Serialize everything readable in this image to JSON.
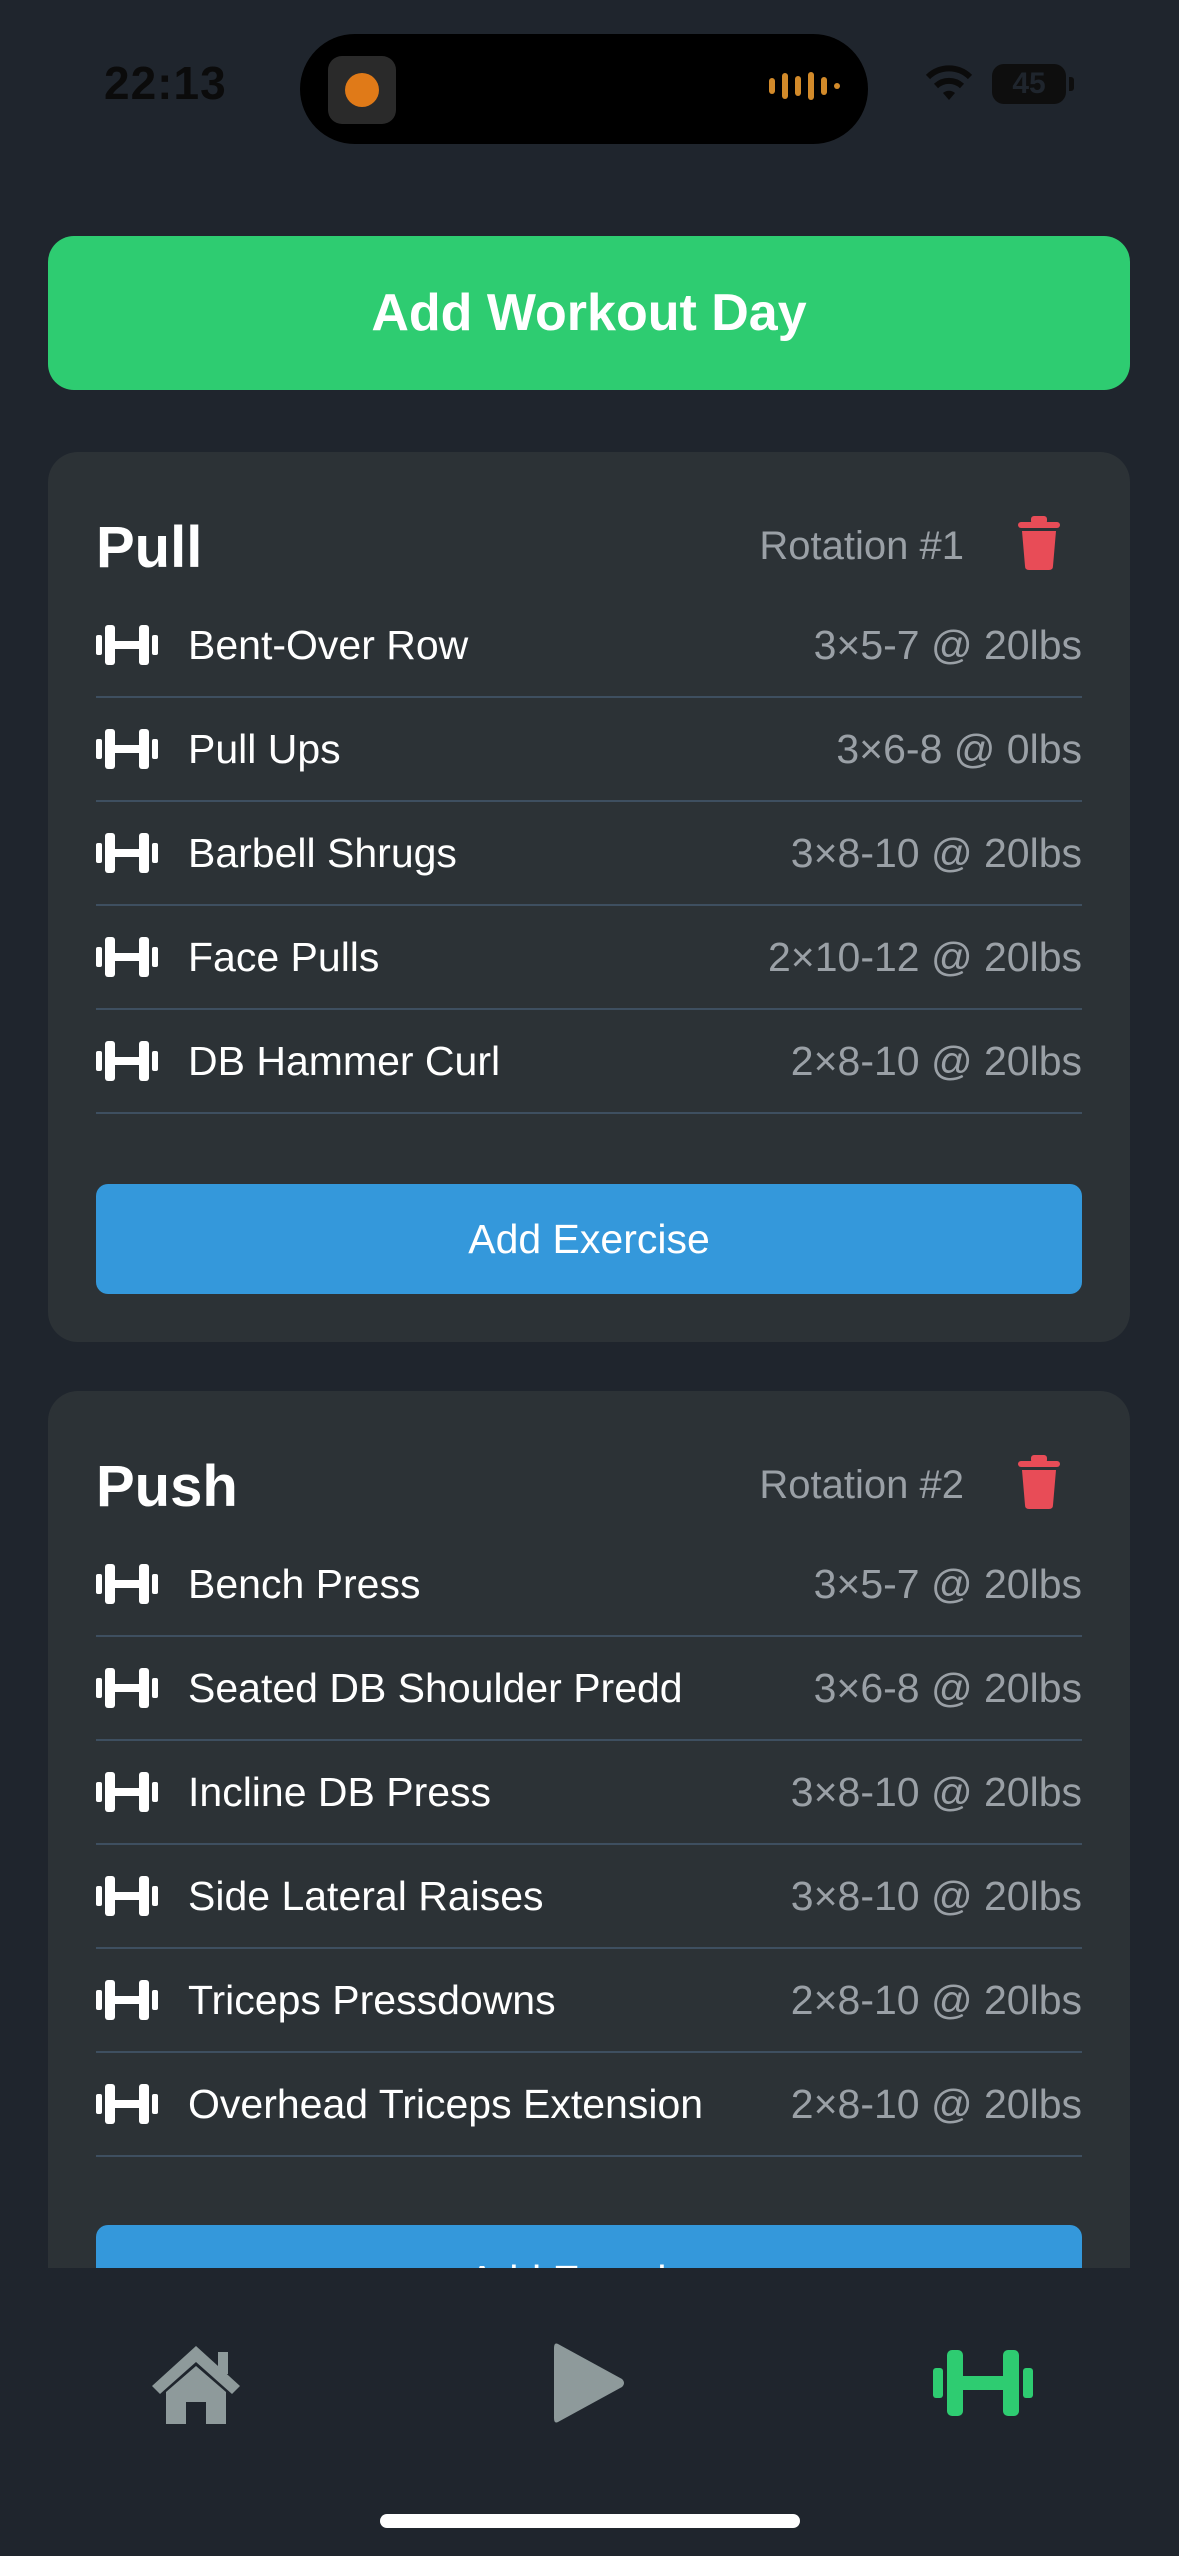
{
  "status_bar": {
    "time": "22:13",
    "battery": "45"
  },
  "add_day_label": "Add Workout Day",
  "days": [
    {
      "title": "Pull",
      "rotation": "Rotation #1",
      "exercises": [
        {
          "name": "Bent-Over Row",
          "sets": "3×5-7 @ 20lbs"
        },
        {
          "name": "Pull Ups",
          "sets": "3×6-8 @ 0lbs"
        },
        {
          "name": "Barbell Shrugs",
          "sets": "3×8-10 @ 20lbs"
        },
        {
          "name": "Face Pulls",
          "sets": "2×10-12 @ 20lbs"
        },
        {
          "name": "DB Hammer Curl",
          "sets": "2×8-10 @ 20lbs"
        }
      ],
      "add_exercise_label": "Add Exercise"
    },
    {
      "title": "Push",
      "rotation": "Rotation #2",
      "exercises": [
        {
          "name": "Bench Press",
          "sets": "3×5-7 @ 20lbs"
        },
        {
          "name": "Seated DB Shoulder Predd",
          "sets": "3×6-8 @ 20lbs"
        },
        {
          "name": "Incline DB Press",
          "sets": "3×8-10 @ 20lbs"
        },
        {
          "name": "Side Lateral Raises",
          "sets": "3×8-10 @ 20lbs"
        },
        {
          "name": "Triceps Pressdowns",
          "sets": "2×8-10 @ 20lbs"
        },
        {
          "name": "Overhead Triceps Extension",
          "sets": "2×8-10 @ 20lbs"
        }
      ],
      "add_exercise_label": "Add Exercise"
    }
  ],
  "tabs": [
    {
      "icon": "home-icon",
      "active": false
    },
    {
      "icon": "play-icon",
      "active": false
    },
    {
      "icon": "dumbbell-icon",
      "active": true
    }
  ],
  "colors": {
    "background": "#1f252d",
    "card": "#2c3236",
    "accent_green": "#2ecc71",
    "accent_blue": "#3498db",
    "delete_red": "#e84c57",
    "muted_text": "#9aa0a6",
    "inactive_tab": "#8e9a9b"
  }
}
